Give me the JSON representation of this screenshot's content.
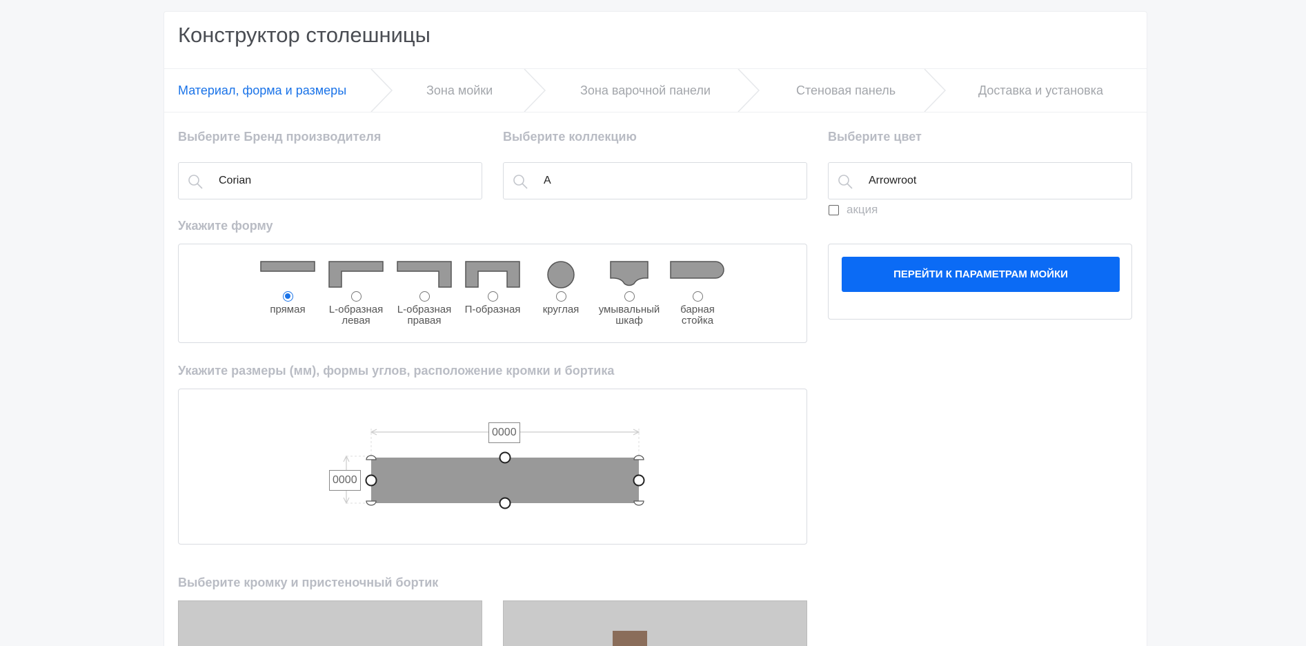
{
  "header": {
    "title": "Конструктор столешницы"
  },
  "steps": [
    {
      "label": "Материал, форма и размеры",
      "active": true
    },
    {
      "label": "Зона мойки",
      "active": false
    },
    {
      "label": "Зона варочной панели",
      "active": false
    },
    {
      "label": "Стеновая панель",
      "active": false
    },
    {
      "label": "Доставка и установка",
      "active": false
    }
  ],
  "brand": {
    "label": "Выберите Бренд производителя",
    "value": "Corian"
  },
  "collection": {
    "label": "Выберите коллекцию",
    "value": "A"
  },
  "color": {
    "label": "Выберите цвет",
    "value": "Arrowroot"
  },
  "promo": {
    "label": "акция",
    "checked": false
  },
  "shape": {
    "label": "Укажите форму",
    "options": [
      {
        "label": "прямая",
        "checked": true,
        "icon": "straight-shape-icon"
      },
      {
        "label": "L-образная левая",
        "checked": false,
        "icon": "l-left-shape-icon"
      },
      {
        "label": "L-образная правая",
        "checked": false,
        "icon": "l-right-shape-icon"
      },
      {
        "label": "П-образная",
        "checked": false,
        "icon": "u-shape-icon"
      },
      {
        "label": "круглая",
        "checked": false,
        "icon": "round-shape-icon"
      },
      {
        "label": "умывальный шкаф",
        "checked": false,
        "icon": "vanity-shape-icon"
      },
      {
        "label": "барная стойка",
        "checked": false,
        "icon": "bar-shape-icon"
      }
    ]
  },
  "dimensions": {
    "label": "Укажите размеры (мм), формы углов, расположение кромки и бортика",
    "width": "0000",
    "height": "0000"
  },
  "edge": {
    "label": "Выберите кромку и пристеночный бортик"
  },
  "cta": {
    "label": "ПЕРЕЙТИ К ПАРАМЕТРАМ МОЙКИ"
  },
  "colors": {
    "accent": "#1a73e8",
    "button": "#0b6bf5",
    "shape_fill": "#999999"
  }
}
